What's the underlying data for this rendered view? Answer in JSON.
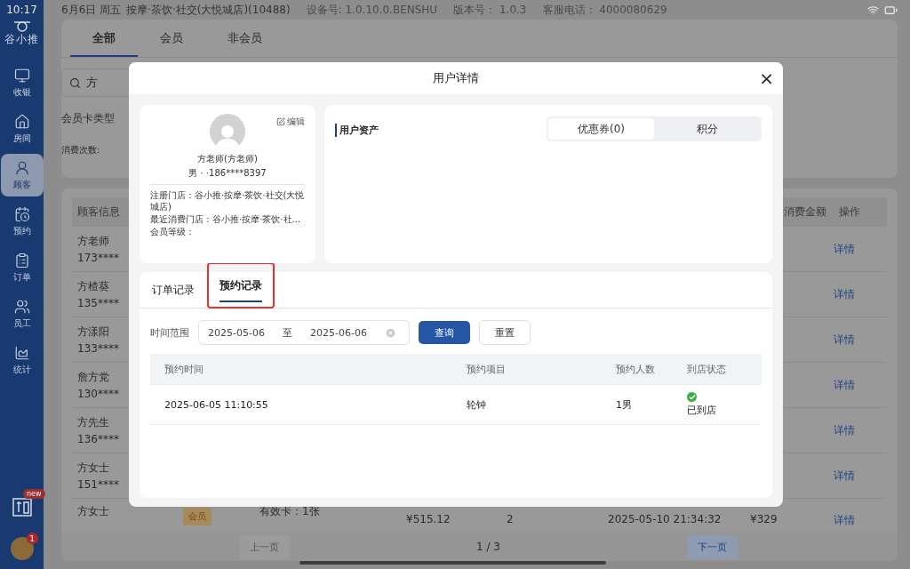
{
  "status_bar": {
    "time": "10:17",
    "date": "6月6日 周五",
    "store": "按摩·茶饮·社交(大悦城店)(10488)",
    "device": "设备号: 1.0.10.0.BENSHU",
    "version": "版本号： 1.0.3",
    "hotline": "客服电话：  4000080629"
  },
  "sidebar": {
    "logo": "谷小推",
    "items": [
      {
        "label": "收银",
        "selected": false
      },
      {
        "label": "房间",
        "selected": false
      },
      {
        "label": "顾客",
        "selected": true
      },
      {
        "label": "预约",
        "selected": false
      },
      {
        "label": "订单",
        "selected": false
      },
      {
        "label": "员工",
        "selected": false
      },
      {
        "label": "统计",
        "selected": false
      }
    ],
    "promo_badge": "new",
    "avatar_badge": "1"
  },
  "tabs": [
    {
      "label": "全部",
      "selected": true
    },
    {
      "label": "会员",
      "selected": false
    },
    {
      "label": "非会员",
      "selected": false
    }
  ],
  "search": {
    "value": "方"
  },
  "filters": [
    "会员卡类型",
    "消费次数:"
  ],
  "table": {
    "columns": [
      "顾客信息",
      "消费金额",
      "操作"
    ],
    "rows": [
      {
        "name": "方老师",
        "phone": "173****",
        "action": "详情"
      },
      {
        "name": "方楂葵",
        "phone": "135****",
        "action": "详情"
      },
      {
        "name": "方漾阳",
        "phone": "133****",
        "action": "详情"
      },
      {
        "name": "詹方党",
        "phone": "130****",
        "action": "详情"
      },
      {
        "name": "方先生",
        "phone": "136****",
        "action": "详情"
      },
      {
        "name": "方女士",
        "phone": "151****",
        "action": "详情"
      },
      {
        "name": "方女士",
        "tag": "会员",
        "card": "有效卡：1张",
        "column_3": "¥515.12",
        "column_4": "2",
        "column_5": "2025-05-10 21:34:32",
        "amount": "¥329",
        "action": "详情"
      }
    ]
  },
  "pagination": {
    "prev": "上一页",
    "prev_disabled": true,
    "page": "1 / 3",
    "next": "下一页"
  },
  "modal": {
    "title": "用户详情",
    "close": "×",
    "profile": {
      "edit": "编辑",
      "name": "方老师(方老师)",
      "info": "男 · ·186****8397",
      "details": [
        "注册门店：谷小推·按摩·茶饮·社交(大悦城店)",
        "最近消费门店：谷小推·按摩·茶饮·社...",
        "会员等级："
      ]
    },
    "assets": {
      "title": "用户资产",
      "segments": [
        {
          "label": "优惠券(0)",
          "selected": true
        },
        {
          "label": "积分",
          "selected": false
        }
      ]
    },
    "tabs": [
      {
        "label": "订单记录",
        "selected": false,
        "highlighted": false
      },
      {
        "label": "预约记录",
        "selected": true,
        "highlighted": true
      }
    ],
    "filter": {
      "label": "时间范围",
      "start": "2025-05-06",
      "separator": "至",
      "end": "2025-06-06",
      "query": "查询",
      "reset": "重置"
    },
    "table": {
      "columns": [
        "预约时间",
        "预约项目",
        "预约人数",
        "到店状态"
      ],
      "rows": [
        {
          "time": "2025-06-05 11:10:55",
          "item": "轮钟",
          "people": "1男",
          "status": "已到店",
          "arrived": true
        }
      ]
    }
  }
}
